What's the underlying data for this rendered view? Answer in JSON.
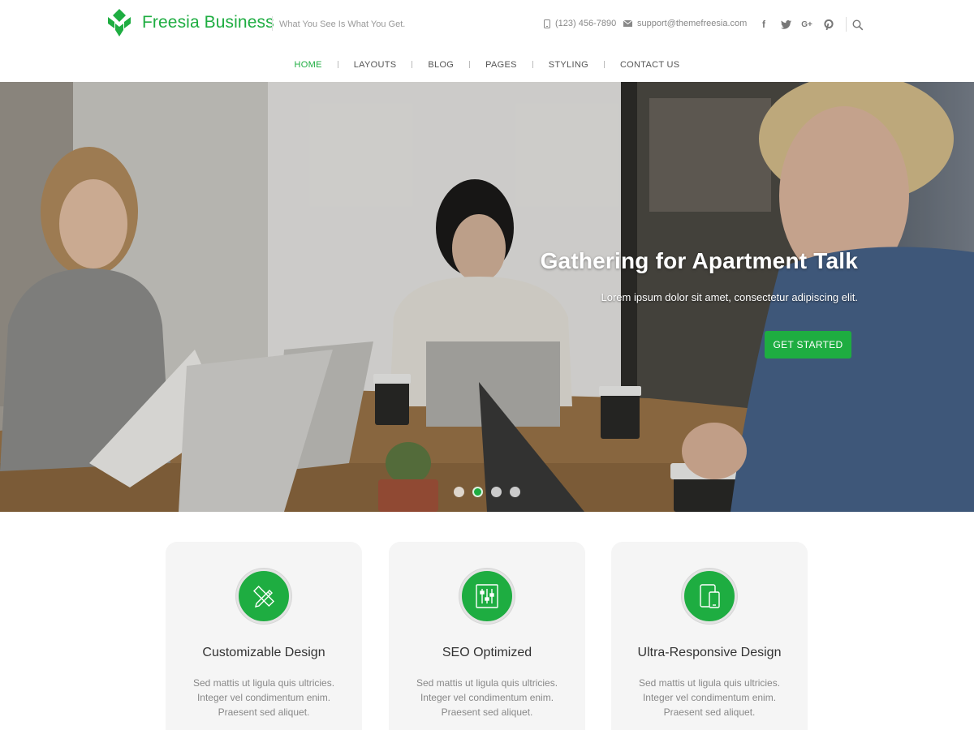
{
  "header": {
    "site_title": "Freesia Business",
    "tagline": "What You See Is What You Get.",
    "phone": "(123) 456-7890",
    "email": "support@themefreesia.com",
    "social": [
      "facebook-icon",
      "twitter-icon",
      "google-plus-icon",
      "pinterest-icon"
    ],
    "brand_color": "#1ead41"
  },
  "nav": {
    "items": [
      {
        "label": "HOME",
        "active": true
      },
      {
        "label": "LAYOUTS"
      },
      {
        "label": "BLOG"
      },
      {
        "label": "PAGES"
      },
      {
        "label": "STYLING"
      },
      {
        "label": "CONTACT US"
      }
    ]
  },
  "hero": {
    "title": "Gathering for Apartment Talk",
    "subtitle": "Lorem ipsum dolor sit amet, consectetur adipiscing elit.",
    "button_label": "GET STARTED",
    "slides": 4,
    "active_slide": 2
  },
  "features": [
    {
      "icon": "pencil-ruler-icon",
      "title": "Customizable Design",
      "lines": [
        "Sed mattis ut ligula quis ultricies.",
        "Integer vel condimentum enim.",
        "Praesent sed aliquet."
      ]
    },
    {
      "icon": "sliders-icon",
      "title": "SEO Optimized",
      "lines": [
        "Sed mattis ut ligula quis ultricies.",
        "Integer vel condimentum enim.",
        "Praesent sed aliquet."
      ]
    },
    {
      "icon": "devices-icon",
      "title": "Ultra-Responsive Design",
      "lines": [
        "Sed mattis ut ligula quis ultricies.",
        "Integer vel condimentum enim.",
        "Praesent sed aliquet."
      ]
    }
  ]
}
